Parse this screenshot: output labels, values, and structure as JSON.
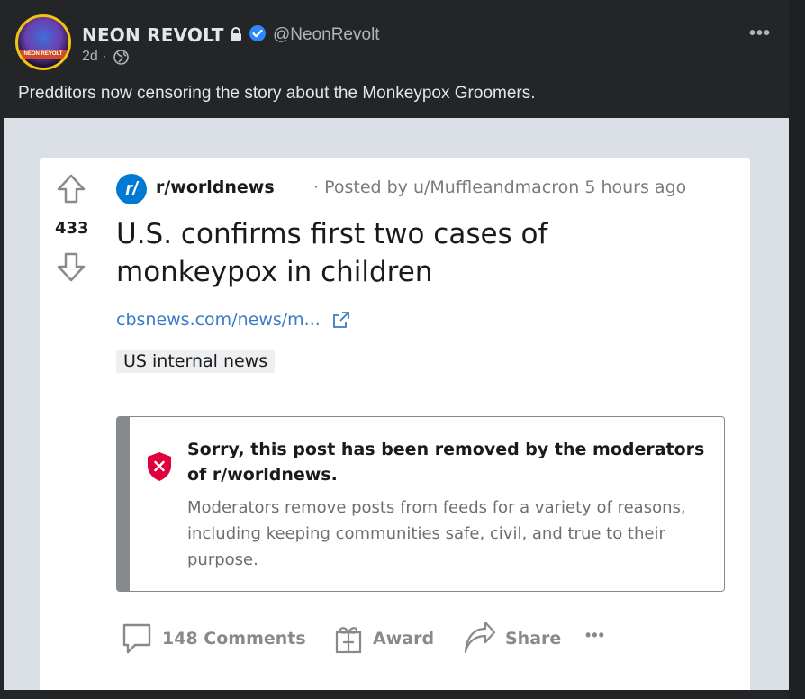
{
  "post": {
    "author_name": "NEON REVOLT",
    "handle": "@NeonRevolt",
    "age": "2d ·",
    "caption": "Predditors now censoring the story about the Monkeypox Groomers.",
    "more_label": "•••",
    "avatar_text": "NEON REVOLT"
  },
  "reddit": {
    "vote_count": "433",
    "subreddit_icon_text": "r/",
    "subreddit": "r/worldnews",
    "posted_by": "· Posted by u/Muffleandmacron 5 hours ago",
    "title": "U.S. confirms first two cases of monkeypox in children",
    "link": "cbsnews.com/news/m...",
    "flair": "US internal news",
    "removed_title": "Sorry, this post has been removed by the moderators of r/worldnews.",
    "removed_body": "Moderators remove posts from feeds for a variety of reasons, including keeping communities safe, civil, and true to their purpose.",
    "comments_label": "148 Comments",
    "award_label": "Award",
    "share_label": "Share",
    "more_label": "•••"
  },
  "colors": {
    "background": "#242526",
    "reddit_blue": "#0079d3",
    "removed_red": "#e0003b",
    "verified_blue": "#2d88ff"
  }
}
